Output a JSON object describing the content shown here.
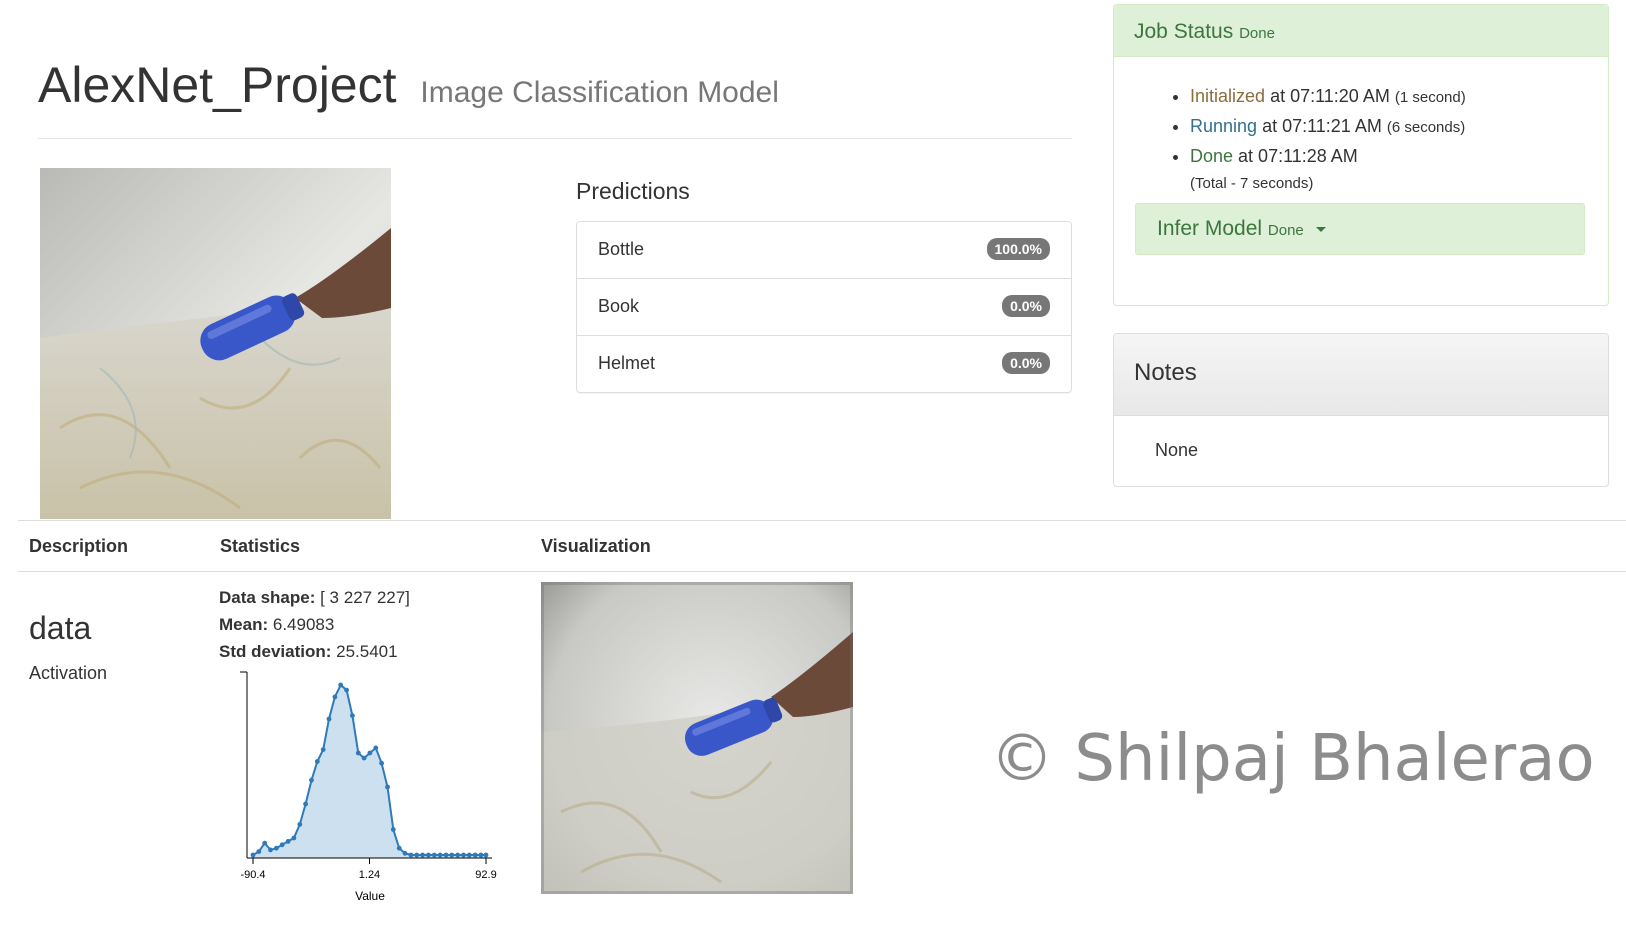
{
  "header": {
    "project_name": "AlexNet_Project",
    "model_type": "Image Classification Model"
  },
  "predictions": {
    "heading": "Predictions",
    "items": [
      {
        "label": "Bottle",
        "value": "100.0%"
      },
      {
        "label": "Book",
        "value": "0.0%"
      },
      {
        "label": "Helmet",
        "value": "0.0%"
      }
    ]
  },
  "job_status": {
    "title": "Job Status",
    "state": "Done",
    "events": [
      {
        "name": "Initialized",
        "at": "at 07:11:20 AM",
        "duration": "(1 second)"
      },
      {
        "name": "Running",
        "at": "at 07:11:21 AM",
        "duration": "(6 seconds)"
      },
      {
        "name": "Done",
        "at": "at 07:11:28 AM",
        "duration": ""
      }
    ],
    "total": "(Total - 7 seconds)",
    "infer_button": {
      "label": "Infer Model",
      "state": "Done"
    }
  },
  "notes": {
    "title": "Notes",
    "body": "None"
  },
  "table": {
    "headers": [
      "Description",
      "Statistics",
      "Visualization"
    ],
    "row": {
      "name": "data",
      "type": "Activation",
      "stats": [
        {
          "label": "Data shape:",
          "value": "[ 3 227 227]"
        },
        {
          "label": "Mean:",
          "value": "6.49083"
        },
        {
          "label": "Std deviation:",
          "value": "25.5401"
        }
      ]
    }
  },
  "chart_data": {
    "type": "area",
    "xlabel": "Value",
    "tick_labels": [
      "-90.4",
      "1.24",
      "92.9"
    ],
    "xlim": [
      -90.4,
      92.9
    ],
    "x": [
      -90.4,
      -85.8,
      -81.2,
      -76.6,
      -72.0,
      -67.4,
      -62.8,
      -58.2,
      -53.6,
      -49.0,
      -44.4,
      -39.8,
      -35.2,
      -30.6,
      -26.0,
      -21.4,
      -16.8,
      -12.2,
      -7.6,
      -3.0,
      1.6,
      6.2,
      10.8,
      15.4,
      20.0,
      24.6,
      29.2,
      33.8,
      38.4,
      43.0,
      47.6,
      52.2,
      56.8,
      61.4,
      66.0,
      70.6,
      75.2,
      79.8,
      84.4,
      88.9,
      92.9
    ],
    "values": [
      0.0,
      0.02,
      0.07,
      0.03,
      0.04,
      0.06,
      0.08,
      0.1,
      0.18,
      0.3,
      0.44,
      0.55,
      0.62,
      0.8,
      0.93,
      1.0,
      0.97,
      0.82,
      0.6,
      0.57,
      0.6,
      0.63,
      0.54,
      0.4,
      0.15,
      0.04,
      0.01,
      0.0,
      0.0,
      0.0,
      0.0,
      0.0,
      0.0,
      0.0,
      0.0,
      0.0,
      0.0,
      0.0,
      0.0,
      0.0,
      0.0
    ],
    "color": "#2f7ab9",
    "fill": "#cde0f0"
  },
  "watermark": "© Shilpaj Bhalerao"
}
